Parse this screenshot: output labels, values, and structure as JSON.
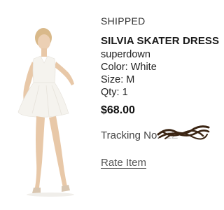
{
  "order": {
    "status": "SHIPPED",
    "product_name": "SILVIA SKATER DRESS",
    "brand": "superdown",
    "color_line": "Color: White",
    "size_line": "Size: M",
    "qty_line": "Qty: 1",
    "price": "$68.00",
    "tracking_label": "Tracking No:",
    "tracking_value": "1Z",
    "rate_item_label": "Rate Item"
  },
  "colors": {
    "scribble": "#3a2412",
    "dress": "#f5f3ee",
    "skin": "#e8c8a8",
    "hair": "#d9b98a"
  },
  "icons": {
    "redaction": "scribble-redaction-icon"
  }
}
